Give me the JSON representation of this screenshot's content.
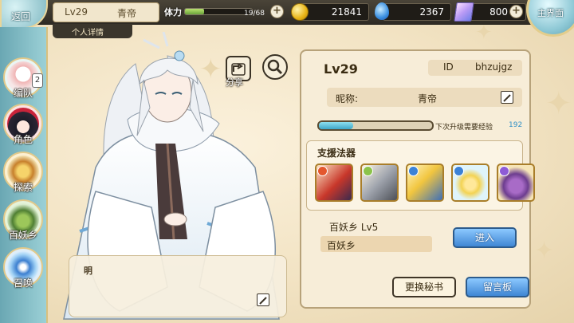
{
  "topbar": {
    "back_label": "返回",
    "level": "Lv29",
    "player_name": "青帝",
    "detail_tab": "个人详情",
    "stamina_label": "体力",
    "stamina_text": "19/68",
    "stamina_fraction": 0.28,
    "gold": "21841",
    "orbs": "2367",
    "crystals": "800",
    "home_label": "主界面"
  },
  "sidebar": {
    "items": [
      {
        "label": "编队",
        "badge": "2"
      },
      {
        "label": "角色"
      },
      {
        "label": "探索"
      },
      {
        "label": "百妖乡"
      },
      {
        "label": "召唤"
      }
    ]
  },
  "actions": {
    "share_label": "分享"
  },
  "dialog": {
    "speaker": "明"
  },
  "profile": {
    "level": "Lv29",
    "id_label": "ID",
    "id_value": "bhzujgz",
    "nickname_label": "昵称:",
    "nickname_value": "青帝",
    "xp_label": "下次升级需要经验",
    "xp_value": "192",
    "xp_fraction": 0.3,
    "support_title": "支援法器",
    "artifacts": [
      {
        "icon": "red-fan-artifact-icon"
      },
      {
        "icon": "crossbow-artifact-icon"
      },
      {
        "icon": "scroll-artifact-icon"
      },
      {
        "icon": "lantern-artifact-icon"
      },
      {
        "icon": "pouch-artifact-icon"
      }
    ],
    "yard_label": "百妖乡  Lv5",
    "yard_name": "百妖乡",
    "enter_label": "进入",
    "swap_secretary_label": "更换秘书",
    "message_board_label": "留言板"
  },
  "colors": {
    "accent_gold": "#e2c98a",
    "button_blue": "#3f86d4",
    "xp_value": "#2e8fc7"
  }
}
